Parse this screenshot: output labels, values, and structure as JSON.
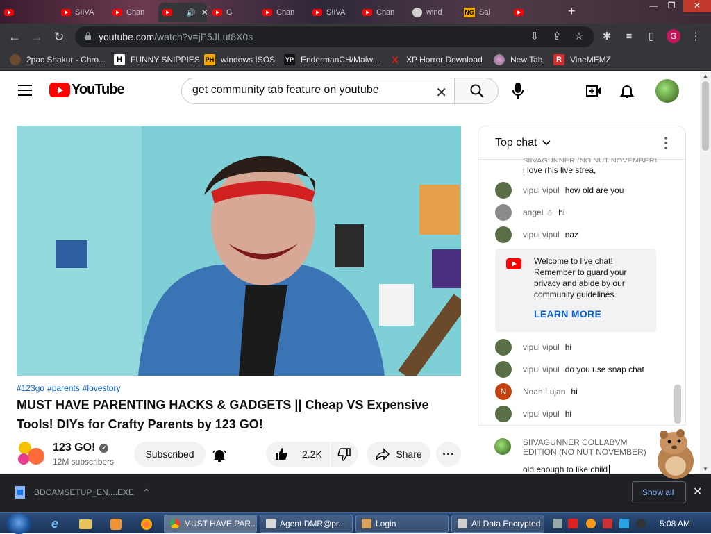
{
  "browser": {
    "tabs": [
      {
        "label": "",
        "active": false
      },
      {
        "label": "SIIVA",
        "active": false
      },
      {
        "label": "Chan",
        "active": false
      },
      {
        "label": "",
        "active": true
      },
      {
        "label": "G",
        "active": false
      },
      {
        "label": "Chan",
        "active": false
      },
      {
        "label": "SIIVA",
        "active": false
      },
      {
        "label": "Chan",
        "active": false
      },
      {
        "label": "wind",
        "active": false
      },
      {
        "label": "Sal",
        "active": false
      },
      {
        "label": "",
        "active": false
      }
    ],
    "url_host": "youtube.com",
    "url_path": "/watch?v=jP5JLut8X0s",
    "profile_initial": "G",
    "bookmarks": [
      {
        "label": "2pac Shakur - Chro...",
        "icon": "2pac-icon"
      },
      {
        "label": "FUNNY SNIPPIES",
        "icon": "h-icon"
      },
      {
        "label": "windows ISOS",
        "icon": "ph-icon"
      },
      {
        "label": "EndermanCH/Malw...",
        "icon": "yp-icon"
      },
      {
        "label": "XP Horror Download",
        "icon": "x-icon"
      },
      {
        "label": "New Tab",
        "icon": "newtab-icon"
      },
      {
        "label": "VineMEMZ",
        "icon": "r-icon"
      }
    ]
  },
  "youtube": {
    "logo_text": "YouTube",
    "search_value": "get community tab feature on youtube",
    "video": {
      "hashtags": [
        "#123go",
        "#parents",
        "#lovestory"
      ],
      "title": "MUST HAVE PARENTING HACKS & GADGETS || Cheap VS Expensive Tools! DIYs for Crafty Parents by 123 GO!",
      "channel_name": "123 GO!",
      "subscribers": "12M subscribers",
      "subscribe_label": "Subscribed",
      "likes": "2.2K",
      "share_label": "Share"
    },
    "chat": {
      "header_label": "Top chat",
      "partial_author": "SIIVAGUNNER (NO NUT NOVEMBER)",
      "partial_message": "i love rhis live strea,",
      "messages_top": [
        {
          "author": "vipul vipul",
          "text": "how old are you",
          "color": "#5a6e48"
        },
        {
          "author": "angel",
          "text": "hi",
          "color": "#8a8a8a"
        },
        {
          "author": "vipul vipul",
          "text": "naz",
          "color": "#5a6e48"
        }
      ],
      "welcome_text": "Welcome to live chat! Remember to guard your privacy and abide by our community guidelines.",
      "learn_more": "LEARN MORE",
      "messages_bottom": [
        {
          "author": "vipul vipul",
          "text": "hi",
          "color": "#5a6e48"
        },
        {
          "author": "vipul vipul",
          "text": "do you use snap chat",
          "color": "#5a6e48"
        },
        {
          "author": "Noah Lujan",
          "text": "hi",
          "color": "#c2410c",
          "initial": "N"
        },
        {
          "author": "vipul vipul",
          "text": "hi",
          "color": "#5a6e48"
        }
      ],
      "input_author": "SIIVAGUNNER COLLABVM EDITION (NO NUT NOVEMBER)",
      "input_value": "old enough to like child"
    }
  },
  "downloads": {
    "file_name": "BDCAMSETUP_EN....EXE",
    "show_all_label": "Show all"
  },
  "taskbar": {
    "windows": [
      {
        "label": "MUST HAVE PAR...",
        "active": true
      },
      {
        "label": "Agent.DMR@pr..."
      },
      {
        "label": "Login"
      },
      {
        "label": "All Data Encrypted"
      }
    ],
    "clock": "5:08 AM"
  }
}
